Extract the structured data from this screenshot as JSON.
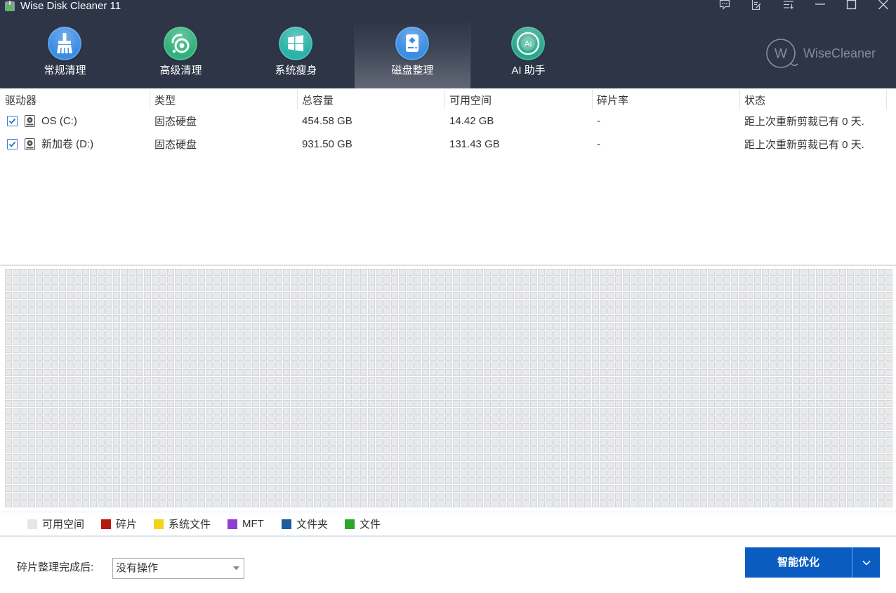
{
  "app": {
    "title": "Wise Disk Cleaner 11"
  },
  "window_controls": [
    "feedback-icon",
    "notes-icon",
    "menu-icon",
    "minimize-icon",
    "maximize-icon",
    "close-icon"
  ],
  "nav": {
    "active_index": 3,
    "tabs": [
      {
        "label": "常规清理",
        "icon": "broom-icon",
        "color": "#3a8de3"
      },
      {
        "label": "高级清理",
        "icon": "advanced-clean-icon",
        "color": "#31b17b"
      },
      {
        "label": "系统瘦身",
        "icon": "windows-icon",
        "color": "#2cb2a6"
      },
      {
        "label": "磁盘整理",
        "icon": "disk-defrag-icon",
        "color": "#3b8ee2"
      },
      {
        "label": "AI 助手",
        "icon": "ai-assistant-icon",
        "icon_text": "Ai",
        "color": "#2aa78b"
      }
    ]
  },
  "brand": {
    "logo_letter": "W",
    "name": "WiseCleaner"
  },
  "table": {
    "columns": [
      "驱动器",
      "类型",
      "总容量",
      "可用空间",
      "碎片率",
      "状态"
    ],
    "rows": [
      {
        "checked": true,
        "icon": "hard-disk-icon",
        "drive": "OS (C:)",
        "type": "固态硬盘",
        "total": "454.58 GB",
        "free": "14.42 GB",
        "fragmentation": "-",
        "status": "距上次重新剪裁已有 0 天."
      },
      {
        "checked": true,
        "icon": "hard-disk-icon",
        "drive": "新加卷 (D:)",
        "type": "固态硬盘",
        "total": "931.50 GB",
        "free": "131.43 GB",
        "fragmentation": "-",
        "status": "距上次重新剪裁已有 0 天."
      }
    ]
  },
  "block_map": {
    "cell_color": "#e8e9eb",
    "cell_border": "#d4d6d9"
  },
  "legend": [
    {
      "label": "可用空间",
      "color": "#e2e6ed"
    },
    {
      "label": "碎片",
      "color": "#b5180f"
    },
    {
      "label": "系统文件",
      "color": "#f5d31a"
    },
    {
      "label": "MFT",
      "color": "#8c3fd2"
    },
    {
      "label": "文件夹",
      "color": "#1d5c9f"
    },
    {
      "label": "文件",
      "color": "#2da72a"
    }
  ],
  "footer": {
    "after_label": "碎片整理完成后:",
    "after_action": "没有操作",
    "optimize_button": "智能优化",
    "optimize_color": "#0b5cc1"
  },
  "colors": {
    "header_bg": "#2d3547"
  }
}
